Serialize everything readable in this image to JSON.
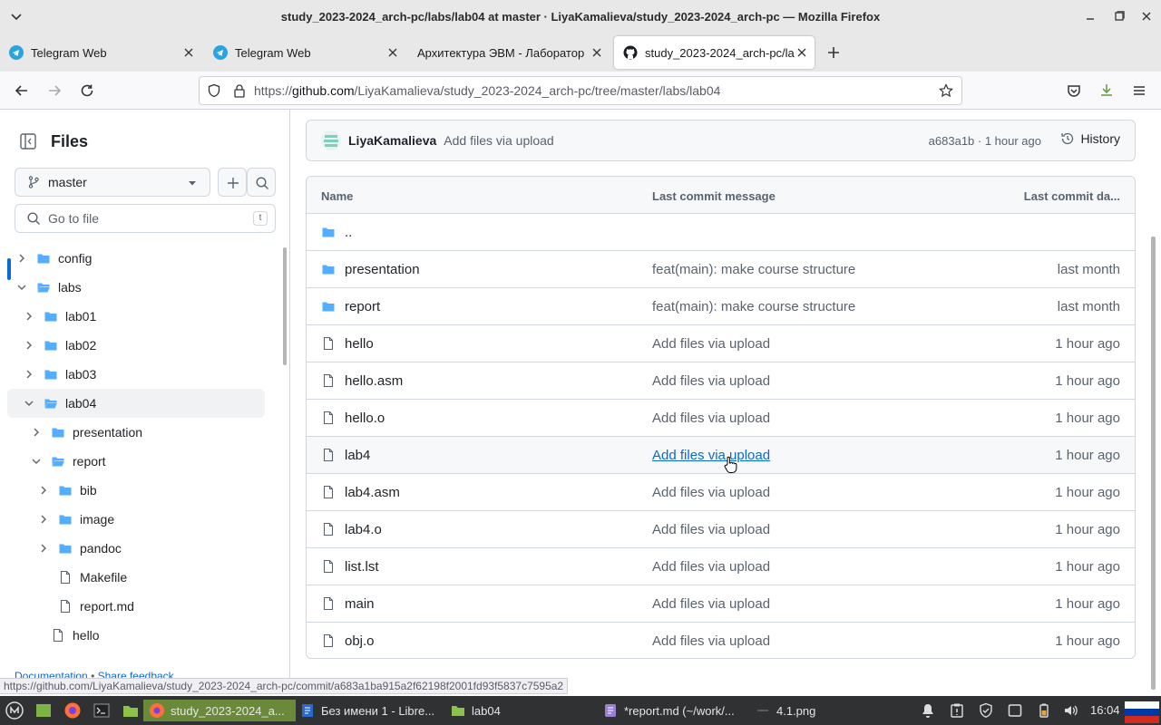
{
  "window": {
    "title": "study_2023-2024_arch-pc/labs/lab04 at master · LiyaKamalieva/study_2023-2024_arch-pc — Mozilla Firefox"
  },
  "tabs": [
    {
      "label": "Telegram Web",
      "icon": "telegram-icon"
    },
    {
      "label": "Telegram Web",
      "icon": "telegram-icon"
    },
    {
      "label": "Архитектура ЭВМ - Лаборатор",
      "icon": "none"
    },
    {
      "label": "study_2023-2024_arch-pc/la",
      "icon": "github-icon",
      "active": true
    }
  ],
  "url": {
    "prefix": "https://",
    "host": "github.com",
    "path": "/LiyaKamalieva/study_2023-2024_arch-pc/tree/master/labs/lab04"
  },
  "sidebar": {
    "title": "Files",
    "branch": "master",
    "search_placeholder": "Go to file",
    "search_shortcut": "t",
    "tree": [
      {
        "label": "config",
        "kind": "folder",
        "depth": 0,
        "expanded": false
      },
      {
        "label": "labs",
        "kind": "folder",
        "depth": 0,
        "expanded": true
      },
      {
        "label": "lab01",
        "kind": "folder",
        "depth": 1,
        "expanded": false
      },
      {
        "label": "lab02",
        "kind": "folder",
        "depth": 1,
        "expanded": false
      },
      {
        "label": "lab03",
        "kind": "folder",
        "depth": 1,
        "expanded": false
      },
      {
        "label": "lab04",
        "kind": "folder",
        "depth": 1,
        "expanded": true,
        "selected": true
      },
      {
        "label": "presentation",
        "kind": "folder",
        "depth": 2,
        "expanded": false
      },
      {
        "label": "report",
        "kind": "folder",
        "depth": 2,
        "expanded": true
      },
      {
        "label": "bib",
        "kind": "folder",
        "depth": 3,
        "expanded": false
      },
      {
        "label": "image",
        "kind": "folder",
        "depth": 3,
        "expanded": false
      },
      {
        "label": "pandoc",
        "kind": "folder",
        "depth": 3,
        "expanded": false
      },
      {
        "label": "Makefile",
        "kind": "file",
        "depth": 3
      },
      {
        "label": "report.md",
        "kind": "file",
        "depth": 3
      },
      {
        "label": "hello",
        "kind": "file",
        "depth": 2
      }
    ],
    "footer": {
      "docs": "Documentation",
      "sep": "•",
      "feedback": "Share feedback"
    }
  },
  "commit": {
    "author": "LiyaKamalieva",
    "message": "Add files via upload",
    "meta": "a683a1b · 1 hour ago",
    "history_label": "History"
  },
  "files": {
    "headers": {
      "name": "Name",
      "message": "Last commit message",
      "date": "Last commit da..."
    },
    "rows": [
      {
        "name": "..",
        "kind": "folder",
        "message": "",
        "date": ""
      },
      {
        "name": "presentation",
        "kind": "folder",
        "message": "feat(main): make course structure",
        "date": "last month"
      },
      {
        "name": "report",
        "kind": "folder",
        "message": "feat(main): make course structure",
        "date": "last month"
      },
      {
        "name": "hello",
        "kind": "file",
        "message": "Add files via upload",
        "date": "1 hour ago"
      },
      {
        "name": "hello.asm",
        "kind": "file",
        "message": "Add files via upload",
        "date": "1 hour ago"
      },
      {
        "name": "hello.o",
        "kind": "file",
        "message": "Add files via upload",
        "date": "1 hour ago"
      },
      {
        "name": "lab4",
        "kind": "file",
        "message": "Add files via upload",
        "date": "1 hour ago",
        "hover": true
      },
      {
        "name": "lab4.asm",
        "kind": "file",
        "message": "Add files via upload",
        "date": "1 hour ago"
      },
      {
        "name": "lab4.o",
        "kind": "file",
        "message": "Add files via upload",
        "date": "1 hour ago"
      },
      {
        "name": "list.lst",
        "kind": "file",
        "message": "Add files via upload",
        "date": "1 hour ago"
      },
      {
        "name": "main",
        "kind": "file",
        "message": "Add files via upload",
        "date": "1 hour ago"
      },
      {
        "name": "obj.o",
        "kind": "file",
        "message": "Add files via upload",
        "date": "1 hour ago"
      }
    ]
  },
  "status_url": "https://github.com/LiyaKamalieva/study_2023-2024_arch-pc/commit/a683a1ba915a2f62198f2001fd93f5837c7595a2",
  "taskbar": {
    "items": [
      {
        "label": "study_2023-2024_a...",
        "icon": "firefox-icon",
        "active": true
      },
      {
        "label": "Без имени 1 - Libre...",
        "icon": "libreoffice-icon"
      },
      {
        "label": "lab04",
        "icon": "folder-icon"
      },
      {
        "label": "*report.md (~/work/...",
        "icon": "text-editor-icon"
      },
      {
        "label": "4.1.png",
        "icon": "image-icon"
      }
    ],
    "clock": "16:04"
  },
  "colors": {
    "accent": "#0969da",
    "folder": "#54aeff",
    "taskbar_active": "#6a8a3a"
  }
}
